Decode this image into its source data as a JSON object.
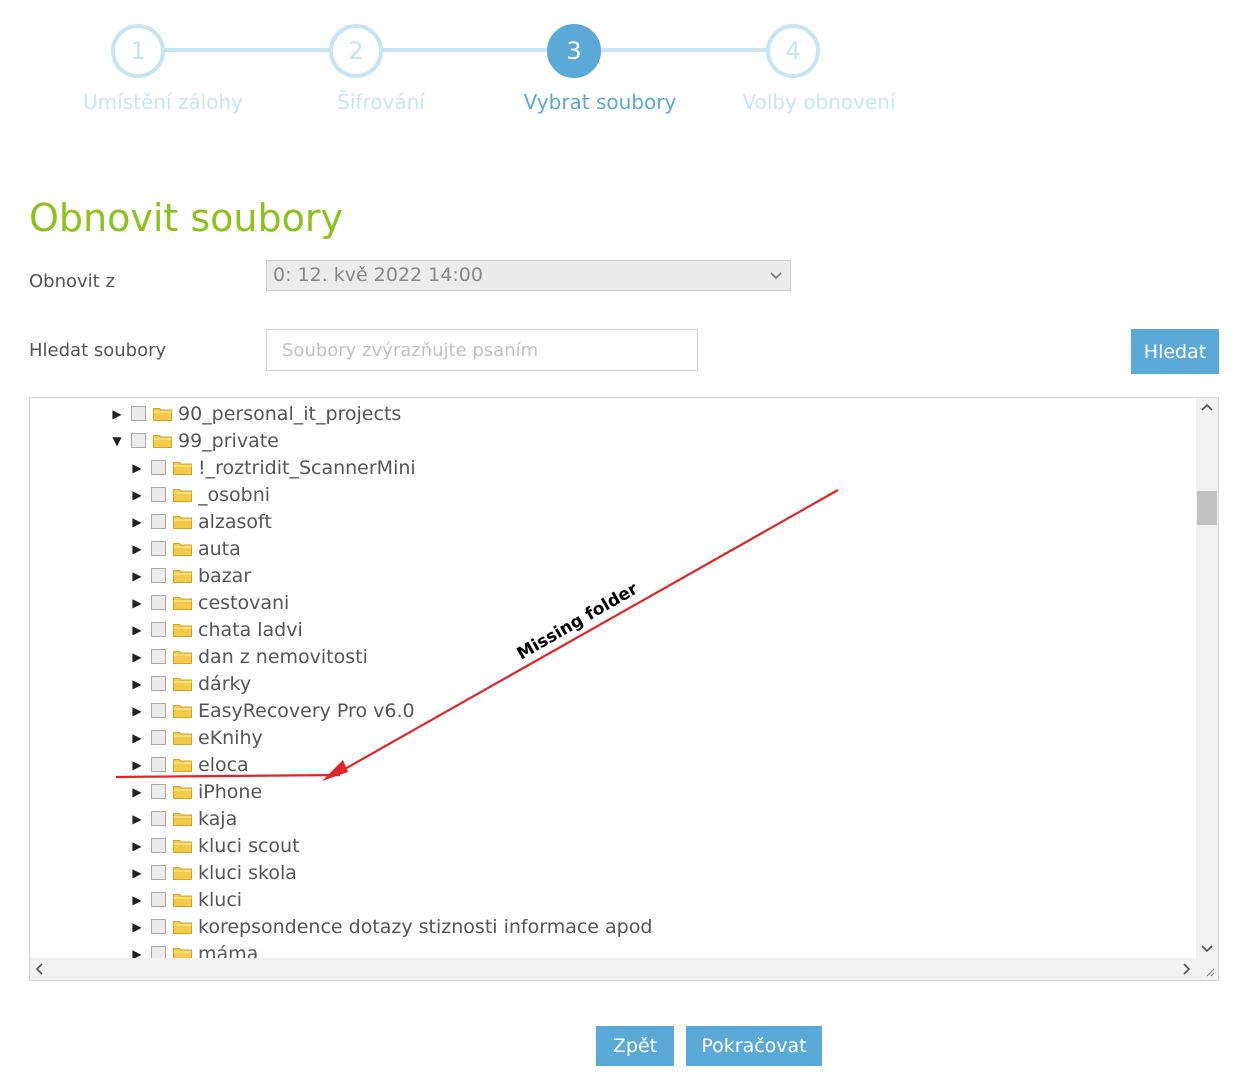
{
  "wizard": {
    "steps": [
      {
        "number": "1",
        "label": "Umístění zálohy",
        "state": "inactive"
      },
      {
        "number": "2",
        "label": "Šifrování",
        "state": "inactive"
      },
      {
        "number": "3",
        "label": "Vybrat soubory",
        "state": "active"
      },
      {
        "number": "4",
        "label": "Volby obnovení",
        "state": "inactive"
      }
    ]
  },
  "page_title": "Obnovit soubory",
  "restore_from": {
    "label": "Obnovit z",
    "selected": "0: 12. kvě 2022 14:00"
  },
  "search": {
    "label": "Hledat soubory",
    "placeholder": "Soubory zvýrazňujte psaním",
    "button": "Hledat"
  },
  "tree": {
    "items": [
      {
        "label": "90_personal_it_projects",
        "level": 0,
        "expanded": false
      },
      {
        "label": "99_private",
        "level": 0,
        "expanded": true
      },
      {
        "label": "!_roztridit_ScannerMini",
        "level": 1,
        "expanded": false
      },
      {
        "label": "_osobni",
        "level": 1,
        "expanded": false
      },
      {
        "label": "alzasoft",
        "level": 1,
        "expanded": false
      },
      {
        "label": "auta",
        "level": 1,
        "expanded": false
      },
      {
        "label": "bazar",
        "level": 1,
        "expanded": false
      },
      {
        "label": "cestovani",
        "level": 1,
        "expanded": false
      },
      {
        "label": "chata ladvi",
        "level": 1,
        "expanded": false
      },
      {
        "label": "dan z nemovitosti",
        "level": 1,
        "expanded": false
      },
      {
        "label": "dárky",
        "level": 1,
        "expanded": false
      },
      {
        "label": "EasyRecovery Pro v6.0",
        "level": 1,
        "expanded": false
      },
      {
        "label": "eKnihy",
        "level": 1,
        "expanded": false
      },
      {
        "label": "eloca",
        "level": 1,
        "expanded": false
      },
      {
        "label": "iPhone",
        "level": 1,
        "expanded": false
      },
      {
        "label": "kaja",
        "level": 1,
        "expanded": false
      },
      {
        "label": "kluci scout",
        "level": 1,
        "expanded": false
      },
      {
        "label": "kluci skola",
        "level": 1,
        "expanded": false
      },
      {
        "label": "kluci",
        "level": 1,
        "expanded": false
      },
      {
        "label": "korepsondence dotazy stiznosti informace apod",
        "level": 1,
        "expanded": false
      },
      {
        "label": "máma",
        "level": 1,
        "expanded": false
      }
    ]
  },
  "annotation": {
    "text": "Missing folder",
    "color": "#e0252b"
  },
  "footer": {
    "back": "Zpět",
    "continue": "Pokračovat"
  },
  "colors": {
    "accent": "#5aa9d6",
    "title_green": "#8cc21d",
    "step_inactive": "#c9e5f3",
    "folder": "#f5c94a"
  }
}
